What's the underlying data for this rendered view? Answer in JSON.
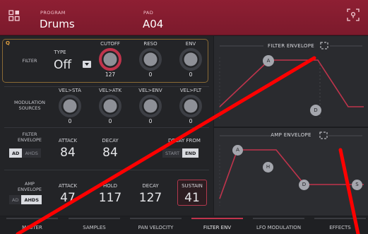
{
  "header": {
    "program_label": "PROGRAM",
    "program_value": "Drums",
    "pad_label": "PAD",
    "pad_value": "A04"
  },
  "filter": {
    "q_badge": "Q",
    "row_label": "FILTER",
    "type_label": "TYPE",
    "type_value": "Off",
    "columns": [
      {
        "label": "CUTOFF",
        "value": "127"
      },
      {
        "label": "RESO",
        "value": "0"
      },
      {
        "label": "ENV",
        "value": "0"
      }
    ]
  },
  "modulation": {
    "row_label_1": "MODULATION",
    "row_label_2": "SOURCES",
    "columns": [
      {
        "label": "VEL>STA",
        "value": "0"
      },
      {
        "label": "VEL>ATK",
        "value": "0"
      },
      {
        "label": "VEL>ENV",
        "value": "0"
      },
      {
        "label": "VEL>FLT",
        "value": "0"
      }
    ]
  },
  "filter_envelope": {
    "row_label_1": "FILTER",
    "row_label_2": "ENVELOPE",
    "mode_ad": "AD",
    "mode_ahds": "AHDS",
    "attack_label": "ATTACK",
    "attack_value": "84",
    "decay_label": "DECAY",
    "decay_value": "84",
    "decay_from_label": "DECAY FROM",
    "decay_from_start": "START",
    "decay_from_end": "END"
  },
  "amp_envelope": {
    "row_label_1": "AMP",
    "row_label_2": "ENVELOPE",
    "mode_ad": "AD",
    "mode_ahds": "AHDS",
    "attack_label": "ATTACK",
    "attack_value": "47",
    "hold_label": "HOLD",
    "hold_value": "117",
    "decay_label": "DECAY",
    "decay_value": "127",
    "sustain_label": "SUSTAIN",
    "sustain_value": "41"
  },
  "graphs": {
    "filter_title": "FILTER ENVELOPE",
    "filter_points": [
      "A",
      "D"
    ],
    "amp_title": "AMP ENVELOPE",
    "amp_points": [
      "A",
      "H",
      "D",
      "S"
    ]
  },
  "tabs": [
    "MASTER",
    "SAMPLES",
    "PAN VELOCITY",
    "FILTER ENV",
    "LFO MODULATION",
    "EFFECTS"
  ],
  "active_tab": "FILTER ENV",
  "colors": {
    "accent": "#c0344c",
    "header": "#8e1f33",
    "annotation": "#ff0000"
  }
}
